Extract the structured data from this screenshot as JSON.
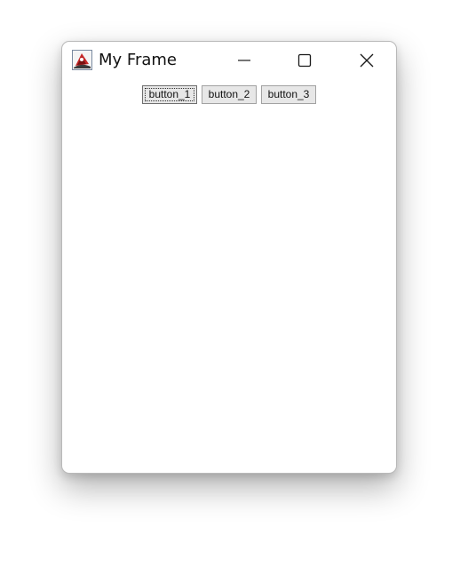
{
  "window": {
    "title": "My Frame",
    "controls": {
      "minimize": "minimize-icon",
      "maximize": "maximize-icon",
      "close": "close-icon"
    }
  },
  "buttons": [
    {
      "label": "button_1",
      "focused": true
    },
    {
      "label": "button_2",
      "focused": false
    },
    {
      "label": "button_3",
      "focused": false
    }
  ],
  "colors": {
    "window_bg": "#ffffff",
    "button_bg": "#e7e7e7",
    "button_border": "#a2a2a2"
  }
}
